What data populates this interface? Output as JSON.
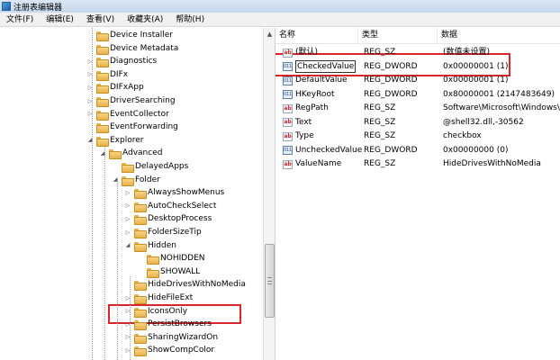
{
  "window": {
    "title": "注册表编辑器"
  },
  "menu": [
    "文件(F)",
    "编辑(E)",
    "查看(V)",
    "收藏夹(A)",
    "帮助(H)"
  ],
  "tree": [
    {
      "label": "Device Installer",
      "depth": 0,
      "expander": ""
    },
    {
      "label": "Device Metadata",
      "depth": 0,
      "expander": ""
    },
    {
      "label": "Diagnostics",
      "depth": 0,
      "expander": "▷"
    },
    {
      "label": "DIFx",
      "depth": 0,
      "expander": "▷"
    },
    {
      "label": "DIFxApp",
      "depth": 0,
      "expander": "▷"
    },
    {
      "label": "DriverSearching",
      "depth": 0,
      "expander": "▷"
    },
    {
      "label": "EventCollector",
      "depth": 0,
      "expander": "▷"
    },
    {
      "label": "EventForwarding",
      "depth": 0,
      "expander": ""
    },
    {
      "label": "Explorer",
      "depth": 0,
      "expander": "◢"
    },
    {
      "label": "Advanced",
      "depth": 1,
      "expander": "◢"
    },
    {
      "label": "DelayedApps",
      "depth": 2,
      "expander": ""
    },
    {
      "label": "Folder",
      "depth": 2,
      "expander": "◢"
    },
    {
      "label": "AlwaysShowMenus",
      "depth": 3,
      "expander": "▷"
    },
    {
      "label": "AutoCheckSelect",
      "depth": 3,
      "expander": "▷"
    },
    {
      "label": "DesktopProcess",
      "depth": 3,
      "expander": "▷"
    },
    {
      "label": "FolderSizeTip",
      "depth": 3,
      "expander": "▷"
    },
    {
      "label": "Hidden",
      "depth": 3,
      "expander": "◢"
    },
    {
      "label": "NOHIDDEN",
      "depth": 4,
      "expander": ""
    },
    {
      "label": "SHOWALL",
      "depth": 4,
      "expander": ""
    },
    {
      "label": "HideDrivesWithNoMedia",
      "depth": 3,
      "expander": ""
    },
    {
      "label": "HideFileExt",
      "depth": 3,
      "expander": "▷"
    },
    {
      "label": "IconsOnly",
      "depth": 3,
      "expander": "▷"
    },
    {
      "label": "PersistBrowsers",
      "depth": 3,
      "expander": "▷"
    },
    {
      "label": "SharingWizardOn",
      "depth": 3,
      "expander": "▷"
    },
    {
      "label": "ShowCompColor",
      "depth": 3,
      "expander": "▷"
    }
  ],
  "columns": {
    "name": "名称",
    "type": "类型",
    "data": "数据"
  },
  "values": [
    {
      "name": "(默认)",
      "type": "REG_SZ",
      "data": "(数值未设置)",
      "icon": "string-value-icon"
    },
    {
      "name": "CheckedValue",
      "type": "REG_DWORD",
      "data": "0x00000001 (1)",
      "icon": "dword-value-icon"
    },
    {
      "name": "DefaultValue",
      "type": "REG_DWORD",
      "data": "0x00000001 (1)",
      "icon": "dword-value-icon"
    },
    {
      "name": "HKeyRoot",
      "type": "REG_DWORD",
      "data": "0x80000001 (2147483649)",
      "icon": "dword-value-icon"
    },
    {
      "name": "RegPath",
      "type": "REG_SZ",
      "data": "Software\\Microsoft\\Windows\\C",
      "icon": "string-value-icon"
    },
    {
      "name": "Text",
      "type": "REG_SZ",
      "data": "@shell32.dll,-30562",
      "icon": "string-value-icon"
    },
    {
      "name": "Type",
      "type": "REG_SZ",
      "data": "checkbox",
      "icon": "string-value-icon"
    },
    {
      "name": "UncheckedValue",
      "type": "REG_DWORD",
      "data": "0x00000000 (0)",
      "icon": "dword-value-icon"
    },
    {
      "name": "ValueName",
      "type": "REG_SZ",
      "data": "HideDrivesWithNoMedia",
      "icon": "string-value-icon"
    }
  ],
  "icons": {
    "string": "ab",
    "dword": "011"
  },
  "colors": {
    "highlight": "#d8262c",
    "folder": "#e8b24a"
  }
}
